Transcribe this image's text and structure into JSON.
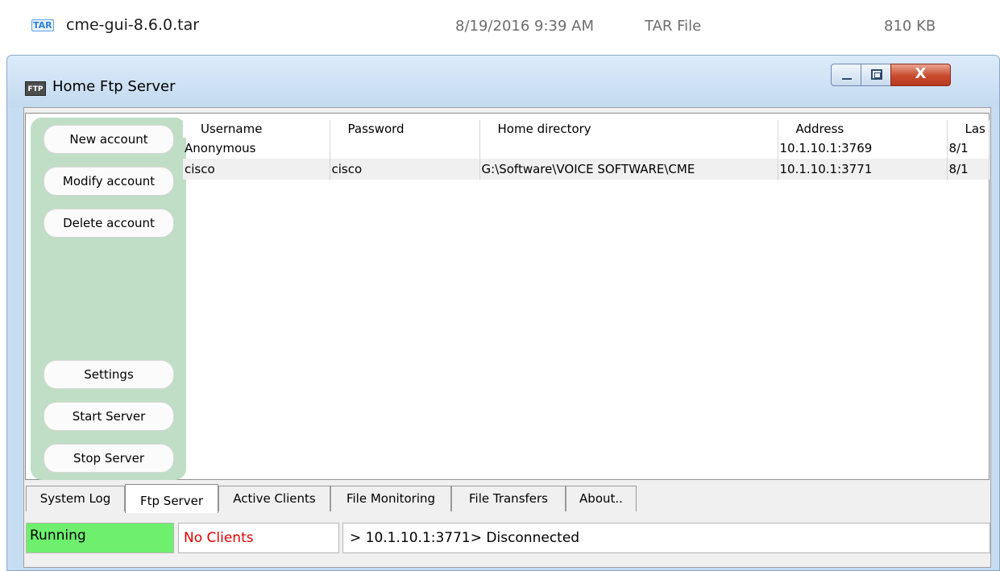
{
  "file_row": {
    "icon_label": "TAR",
    "name": "cme-gui-8.6.0.tar",
    "date": "8/19/2016 9:39 AM",
    "type": "TAR File",
    "size": "810 KB"
  },
  "window": {
    "icon_label": "FTP",
    "title": "Home Ftp Server",
    "controls": {
      "minimize": "minimize",
      "maximize": "maximize",
      "close": "X"
    }
  },
  "sidebar": {
    "buttons": [
      "New account",
      "Modify account",
      "Delete account",
      "Settings",
      "Start Server",
      "Stop Server"
    ]
  },
  "accounts_table": {
    "columns": [
      "Username",
      "Password",
      "Home directory",
      "Address",
      "Las"
    ],
    "rows": [
      [
        "Anonymous",
        "",
        "",
        "10.1.10.1:3769",
        "8/1"
      ],
      [
        "cisco",
        "cisco",
        "G:\\Software\\VOICE SOFTWARE\\CME",
        "10.1.10.1:3771",
        "8/1"
      ]
    ]
  },
  "tabs": {
    "items": [
      "System Log",
      "Ftp Server",
      "Active Clients",
      "File Monitoring",
      "File Transfers",
      "About.."
    ],
    "active": "Ftp Server"
  },
  "status": {
    "server_state": "Running",
    "clients": "No Clients",
    "message": "> 10.1.10.1:3771> Disconnected"
  },
  "colors": {
    "running_bg": "#6ef06e",
    "no_clients_text": "#e00000",
    "sidebar_bg": "#c0dec6",
    "close_button": "#c94a2e"
  }
}
